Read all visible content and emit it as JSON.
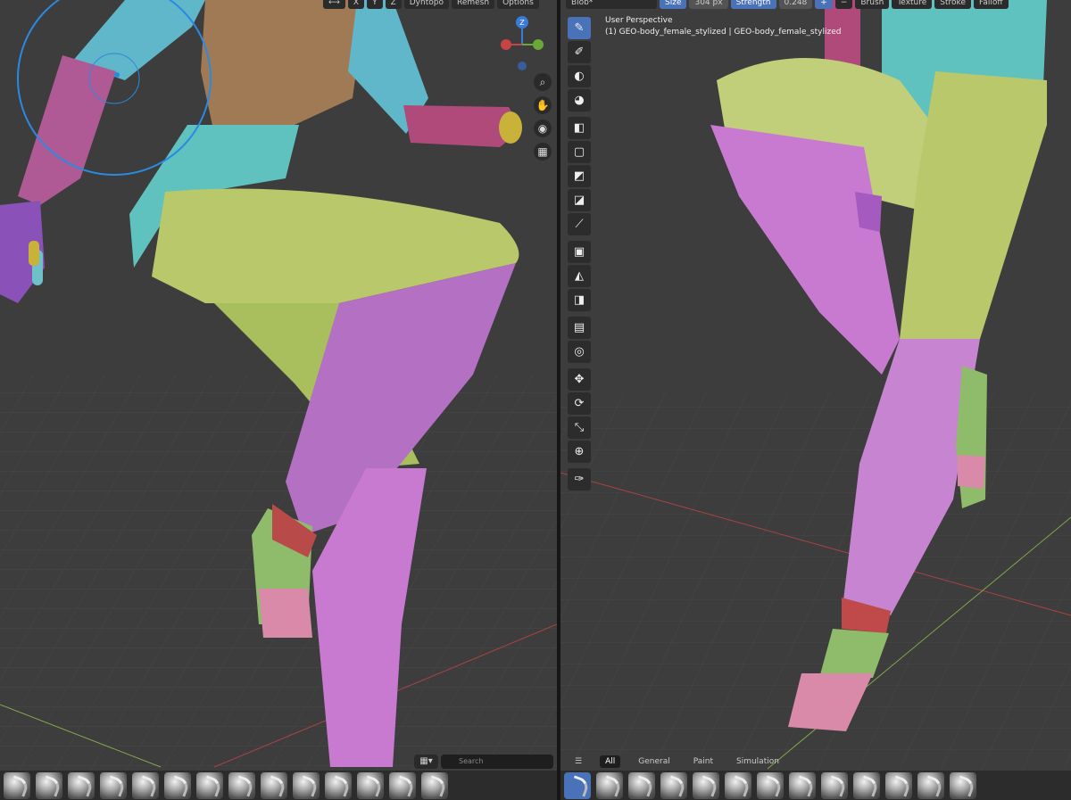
{
  "left_header": {
    "axes": [
      "X",
      "Y",
      "Z"
    ],
    "dyntopo_label": "Dyntopo",
    "remesh_label": "Remesh",
    "options_label": "Options"
  },
  "right_header": {
    "brush_name": "Blob*",
    "size_label": "Size",
    "size_value": "304 px",
    "strength_label": "Strength",
    "strength_value": "0.248",
    "brush_menu": "Brush",
    "texture_menu": "Texture",
    "stroke_menu": "Stroke",
    "falloff_menu": "Falloff"
  },
  "viewport_overlay": {
    "perspective": "User Perspective",
    "object_info": "(1) GEO-body_female_stylized | GEO-body_female_stylized"
  },
  "gizmo": {
    "z_label": "Z"
  },
  "asset_shelf": {
    "search_placeholder": "Search",
    "tabs": [
      "All",
      "General",
      "Paint",
      "Simulation"
    ]
  },
  "icons": {
    "nav": [
      "zoom-icon",
      "pan-hand-icon",
      "camera-icon",
      "grid-ortho-icon"
    ],
    "tools": [
      "draw-brush-icon",
      "smooth-brush-icon",
      "mask-brush-icon",
      "color-paint-icon",
      "box-mask-icon",
      "box-hide-icon",
      "box-face-set-icon",
      "box-trim-icon",
      "line-project-icon",
      "mesh-filter-icon",
      "cloth-filter-icon",
      "color-filter-icon",
      "edit-face-set-icon",
      "mask-by-color-icon",
      "move-icon",
      "rotate-icon",
      "scale-icon",
      "transform-icon",
      "annotate-icon"
    ]
  },
  "colors": {
    "viewport_bg": "#3d3d3d",
    "accent_blue": "#4a72b8",
    "teal": "#5fc2bf",
    "yellow_green": "#b8c86a",
    "magenta": "#c77ad0",
    "skin": "#a07a55",
    "red": "#c04a4a"
  }
}
